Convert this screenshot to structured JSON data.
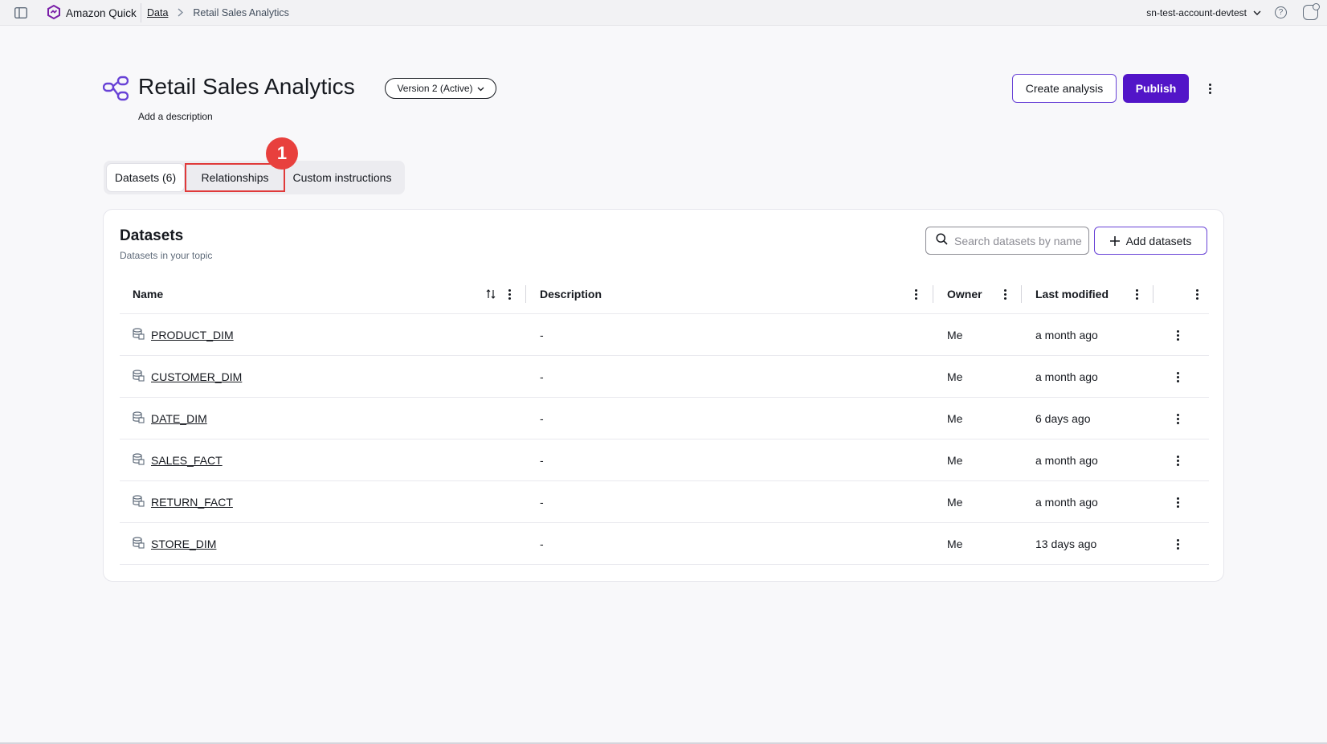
{
  "topbar": {
    "brand": "Amazon Quick",
    "breadcrumb_link": "Data",
    "breadcrumb_current": "Retail Sales Analytics",
    "account": "sn-test-account-devtest",
    "help_glyph": "?"
  },
  "header": {
    "title": "Retail Sales Analytics",
    "version": "Version 2 (Active)",
    "add_description": "Add a description",
    "create_analysis": "Create analysis",
    "publish": "Publish"
  },
  "colors": {
    "brand_purple": "#5215c8",
    "accent_border": "#6842d6",
    "highlight_red": "#e03a3a",
    "badge_red": "#e8403d"
  },
  "tabs": [
    {
      "label": "Datasets (6)",
      "selected": true
    },
    {
      "label": "Relationships",
      "highlighted": true
    },
    {
      "label": "Custom instructions"
    }
  ],
  "step_badge": "1",
  "datasets": {
    "title": "Datasets",
    "subtitle": "Datasets in your topic",
    "search_placeholder": "Search datasets by name",
    "add_label": "Add datasets",
    "columns": {
      "name": "Name",
      "description": "Description",
      "owner": "Owner",
      "last_modified": "Last modified"
    },
    "rows": [
      {
        "name": "PRODUCT_DIM",
        "description": "-",
        "owner": "Me",
        "modified": "a month ago"
      },
      {
        "name": "CUSTOMER_DIM",
        "description": "-",
        "owner": "Me",
        "modified": "a month ago"
      },
      {
        "name": "DATE_DIM",
        "description": "-",
        "owner": "Me",
        "modified": "6 days ago"
      },
      {
        "name": "SALES_FACT",
        "description": "-",
        "owner": "Me",
        "modified": "a month ago"
      },
      {
        "name": "RETURN_FACT",
        "description": "-",
        "owner": "Me",
        "modified": "a month ago"
      },
      {
        "name": "STORE_DIM",
        "description": "-",
        "owner": "Me",
        "modified": "13 days ago"
      }
    ]
  }
}
